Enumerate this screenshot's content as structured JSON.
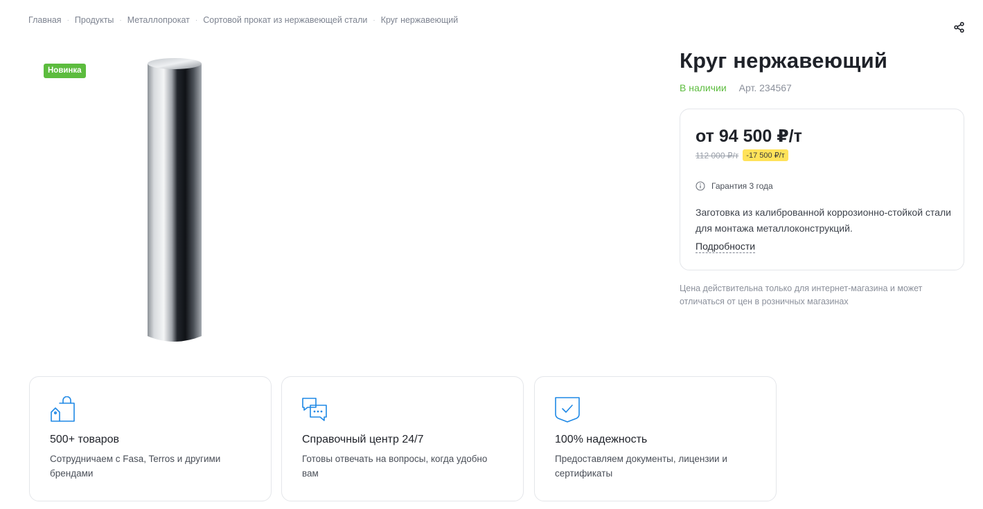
{
  "breadcrumb": {
    "items": [
      "Главная",
      "Продукты",
      "Металлопрокат",
      "Сортовой прокат из нержавеющей стали",
      "Круг нержавеющий"
    ],
    "separator": "·"
  },
  "product": {
    "badge": "Новинка",
    "title": "Круг нержавеющий",
    "stock": "В наличии",
    "article": "Арт. 234567",
    "price": "от 94 500 ₽/т",
    "old_price": "112 000 ₽/т",
    "discount": "-17 500 ₽/т",
    "warranty": "Гарантия 3 года",
    "description": "Заготовка из калиброванной коррозионно-стойкой стали для монтажа металлоконструкций.",
    "details_link": "Подробности",
    "price_note": "Цена действительна только для интернет-магазина и может отличаться от цен в розничных магазинах"
  },
  "features": [
    {
      "icon": "shopping-bag-icon",
      "title": "500+ товаров",
      "text": "Сотрудничаем с Fasa, Terros и другими брендами"
    },
    {
      "icon": "chat-bubbles-icon",
      "title": "Справочный центр 24/7",
      "text": "Готовы отвечать на вопросы, когда удобно вам"
    },
    {
      "icon": "shield-check-icon",
      "title": "100% надежность",
      "text": "Предоставляем документы, лицензии и сертификаты"
    }
  ],
  "colors": {
    "accent_green": "#5cbc3e",
    "icon_blue": "#1e88e5",
    "discount_yellow": "#ffe25a"
  },
  "icons": {
    "share": "share-icon",
    "info": "info-icon"
  }
}
